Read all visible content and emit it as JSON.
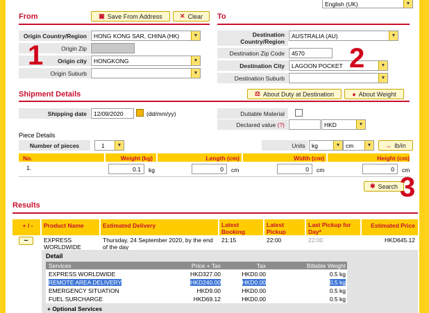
{
  "language": "English (UK)",
  "from": {
    "title": "From",
    "save_btn": "Save From Address",
    "clear_btn": "Clear",
    "origin_country_label": "Origin Country/Region",
    "origin_country_value": "HONG KONG SAR, CHINA (HK)",
    "origin_zip_label": "Origin Zip",
    "origin_city_label": "Origin city",
    "origin_city_value": "HONGKONG",
    "origin_suburb_label": "Origin Suburb",
    "marker": "1"
  },
  "to": {
    "title": "To",
    "dest_country_label": "Destination Country/Region",
    "dest_country_value": "AUSTRALIA (AU)",
    "dest_zip_label": "Destination Zip Code",
    "dest_zip_value": "4570",
    "dest_city_label": "Destination City",
    "dest_city_value": "LAGOON POCKET",
    "dest_suburb_label": "Destination Suburb",
    "marker": "2"
  },
  "shipment": {
    "title": "Shipment Details",
    "duty_btn": "About Duty at Destination",
    "weight_btn": "About Weight",
    "shipping_date_label": "Shipping date",
    "shipping_date_value": "12/09/2020",
    "date_format": "(dd/mm/yy)",
    "dutiable_label": "Dutiable Material",
    "declared_label": "Declared value",
    "declared_help": "(?)",
    "currency": "HKD"
  },
  "piece": {
    "title": "Piece Details",
    "num_pieces_label": "Number of pieces",
    "num_pieces_value": "1",
    "units_label": "Units",
    "unit_weight": "kg",
    "unit_length": "cm",
    "lbin_btn": "lb/in",
    "headers": [
      "No.",
      "Weight (kg)",
      "Length (cm)",
      "Width (cm)",
      "Height (cm)"
    ],
    "row": {
      "no": "1.",
      "weight": "0.1",
      "weight_unit": "kg",
      "length": "0",
      "length_unit": "cm",
      "width": "0",
      "width_unit": "cm",
      "height": "0",
      "height_unit": "cm"
    },
    "search_btn": "Search",
    "marker": "3"
  },
  "results": {
    "title": "Results",
    "headers": [
      "+ / -",
      "Product Name",
      "Estimated Delivery",
      "Latest Booking",
      "Latest Pickup",
      "Last Pickup for Day*",
      "Estimated Price"
    ],
    "row": {
      "toggle": "−",
      "product": "EXPRESS WORLDWIDE",
      "delivery": "Thursday, 24 September 2020, by the end of the day",
      "booking": "21:15",
      "pickup": "22:00",
      "last_pickup": "22:00",
      "price": "HKD645.12"
    },
    "detail": {
      "title": "Detail",
      "headers": [
        "Services",
        "Price + Tax",
        "Tax",
        "Billable Weight"
      ],
      "rows": [
        {
          "service": "EXPRESS WORLDWIDE",
          "price": "HKD327.00",
          "tax": "HKD0.00",
          "weight": "0.5 kg"
        },
        {
          "service": "REMOTE AREA DELIVERY",
          "price": "HKD240.00",
          "tax": "HKD0.00",
          "weight": "0.5 kg"
        },
        {
          "service": "EMERGENCY SITUATION",
          "price": "HKD9.00",
          "tax": "HKD0.00",
          "weight": "0.5 kg"
        },
        {
          "service": "FUEL SURCHARGE",
          "price": "HKD69.12",
          "tax": "HKD0.00",
          "weight": "0.5 kg"
        }
      ],
      "optional": "+ Optional Services"
    }
  }
}
